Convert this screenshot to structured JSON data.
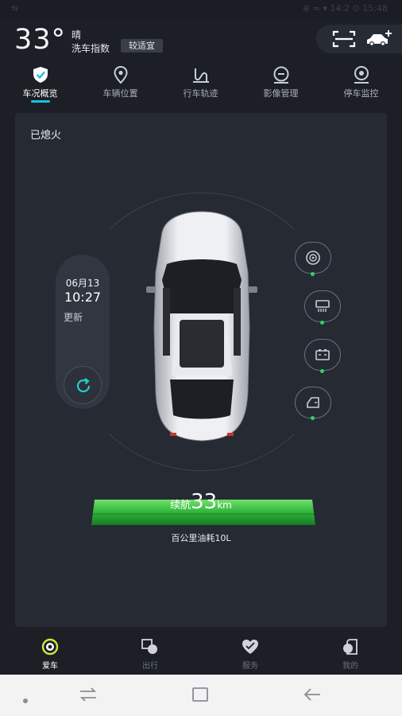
{
  "status_bar": {
    "left": "⇆",
    "right": "⊕  ≈  ▾  14:2  ⊙  15:48"
  },
  "header": {
    "temperature": "33°",
    "weather": "晴",
    "wash_index_label": "洗车指数",
    "wash_index_value": "较适宜",
    "icons": [
      "scan-icon",
      "add-car-icon"
    ]
  },
  "tabs": [
    {
      "label": "车况概览",
      "icon": "shield-check-icon",
      "active": true
    },
    {
      "label": "车辆位置",
      "icon": "location-pin-icon",
      "active": false
    },
    {
      "label": "行车轨迹",
      "icon": "route-icon",
      "active": false
    },
    {
      "label": "影像管理",
      "icon": "camera-lens-icon",
      "active": false
    },
    {
      "label": "停车监控",
      "icon": "parking-monitor-icon",
      "active": false
    }
  ],
  "overview": {
    "engine_status": "已熄火",
    "update": {
      "date": "06月13",
      "time": "10:27",
      "label": "更新"
    },
    "status_icons": [
      {
        "name": "tire-icon",
        "status": "ok"
      },
      {
        "name": "defrost-icon",
        "status": "ok"
      },
      {
        "name": "battery-icon",
        "status": "ok"
      },
      {
        "name": "door-icon",
        "status": "ok"
      }
    ],
    "range": {
      "prefix": "续航",
      "value": "33",
      "unit": "km"
    },
    "fuel_consumption": "百公里油耗10L"
  },
  "bottom_nav": [
    {
      "label": "爱车",
      "icon": "car-ring-icon",
      "active": true
    },
    {
      "label": "出行",
      "icon": "trip-icon",
      "active": false
    },
    {
      "label": "服务",
      "icon": "heart-service-icon",
      "active": false
    },
    {
      "label": "我的",
      "icon": "profile-icon",
      "active": false
    }
  ],
  "colors": {
    "background": "#1c1f26",
    "card": "#262a33",
    "accent": "#18c1e4",
    "range_green": "#2fb53a",
    "status_ok": "#2ed36a"
  }
}
